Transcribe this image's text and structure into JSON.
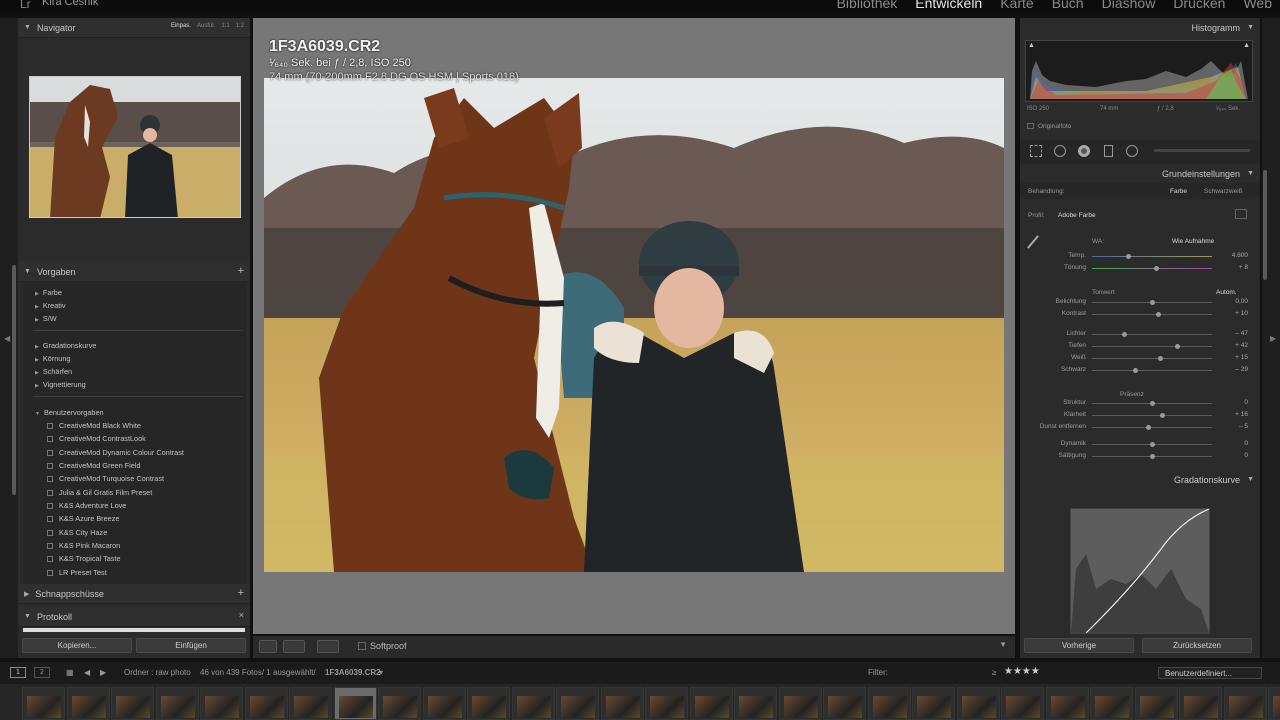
{
  "app": {
    "logo": "Lr",
    "user": "Kira Česnik",
    "modules": [
      {
        "label": "Bibliothek",
        "active": false
      },
      {
        "label": "Entwickeln",
        "active": true
      },
      {
        "label": "Karte",
        "active": false
      },
      {
        "label": "Buch",
        "active": false
      },
      {
        "label": "Diashow",
        "active": false
      },
      {
        "label": "Drucken",
        "active": false
      },
      {
        "label": "Web",
        "active": false
      }
    ]
  },
  "left": {
    "navigator": {
      "title": "Navigator",
      "zoom": [
        "Einpas.",
        "Ausfül.",
        "1:1",
        "1:2"
      ]
    },
    "vorgaben": {
      "title": "Vorgaben",
      "groups1": [
        "Farbe",
        "Kreativ",
        "S/W"
      ],
      "groups2": [
        "Gradationskurve",
        "Körnung",
        "Schärfen",
        "Vignettierung"
      ],
      "user_folder": "Benutzervorgaben",
      "user_presets": [
        "CreativeMod Black White",
        "CreativeMod ContrastLook",
        "CreativeMod Dynamic Colour Contrast",
        "CreativeMod Green Field",
        "CreativeMod Turquoise Contrast",
        "Julia & Gil Gratis Film Preset",
        "K&S Adventure Love",
        "K&S Azure Breeze",
        "K&S City Haze",
        "K&S Pink Macaron",
        "K&S Tropical Taste",
        "LR Preset Test"
      ]
    },
    "schnappschuesse": "Schnappschüsse",
    "protokoll": "Protokoll",
    "buttons": {
      "copy": "Kopieren...",
      "paste": "Einfügen"
    }
  },
  "center": {
    "filename": "1F3A6039.CR2",
    "exposure": "¹⁄₆₄₀ Sek. bei ƒ / 2,8, ISO 250",
    "lens": "74 mm (70-200mm F2.8 DG OS HSM | Sports 018)",
    "softproof": "Softproof"
  },
  "right": {
    "histogram": {
      "title": "Histogramm",
      "iso": "ISO 250",
      "focal": "74 mm",
      "aperture": "ƒ / 2,8",
      "shutter": "¹⁄₆₄₀ Sek.",
      "original": "Originalfoto"
    },
    "basic": {
      "title": "Grundeinstellungen",
      "treatment_label": "Behandlung:",
      "treatment_color": "Farbe",
      "treatment_bw": "Schwarzweiß",
      "profile_label": "Profil:",
      "profile_value": "Adobe Farbe",
      "wb_label": "WA:",
      "wb_value": "Wie Aufnahme",
      "tone_label": "Tonwert",
      "tone_auto": "Autom.",
      "presence_label": "Präsenz"
    },
    "sliders": [
      {
        "label": "Temp.",
        "value": "4.800",
        "pos": 0.3
      },
      {
        "label": "Tönung",
        "value": "+ 8",
        "pos": 0.53
      },
      {
        "label": "Belichtung",
        "value": "0,00",
        "pos": 0.5
      },
      {
        "label": "Kontrast",
        "value": "+ 10",
        "pos": 0.55
      },
      {
        "label": "Lichter",
        "value": "– 47",
        "pos": 0.27
      },
      {
        "label": "Tiefen",
        "value": "+ 42",
        "pos": 0.71
      },
      {
        "label": "Weiß",
        "value": "+ 15",
        "pos": 0.57
      },
      {
        "label": "Schwarz",
        "value": "– 29",
        "pos": 0.36
      },
      {
        "label": "Struktur",
        "value": "0",
        "pos": 0.5
      },
      {
        "label": "Klarheit",
        "value": "+ 16",
        "pos": 0.58
      },
      {
        "label": "Dunst entfernen",
        "value": "– 5",
        "pos": 0.47
      },
      {
        "label": "Dynamik",
        "value": "0",
        "pos": 0.5
      },
      {
        "label": "Sättigung",
        "value": "0",
        "pos": 0.5
      }
    ],
    "curve_title": "Gradationskurve",
    "buttons": {
      "prev": "Vorherige",
      "reset": "Zurücksetzen"
    }
  },
  "filmstrip": {
    "views": [
      "1",
      "2"
    ],
    "path": "Ordner : raw photo",
    "count": "46 von 439 Fotos/ 1 ausgewählt/",
    "selected": "1F3A6039.CR2",
    "filter_label": "Filter:",
    "rating_op": "≥",
    "stars": "★★★★",
    "custom": "Benutzerdefiniert..."
  }
}
